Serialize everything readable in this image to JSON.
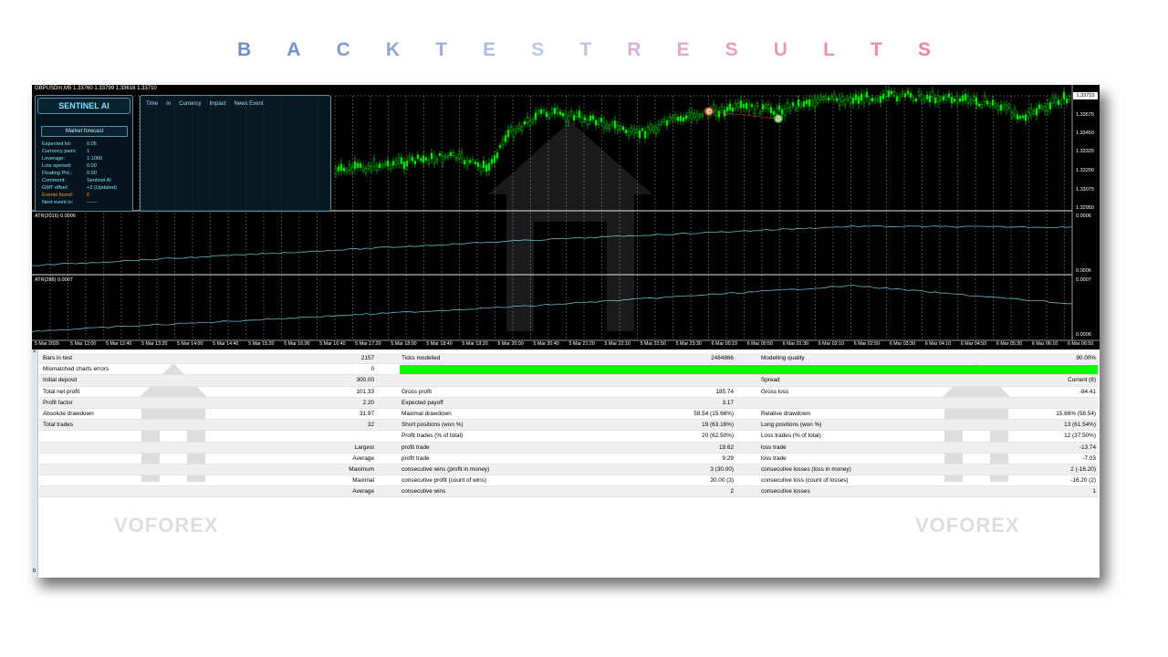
{
  "title_letters": [
    {
      "ch": "B",
      "color": "#6f8fc9"
    },
    {
      "ch": "A",
      "color": "#7294cb"
    },
    {
      "ch": "C",
      "color": "#7f9bd0"
    },
    {
      "ch": "K",
      "color": "#8aa6d6"
    },
    {
      "ch": "T",
      "color": "#97b2da"
    },
    {
      "ch": "E",
      "color": "#a7c0de"
    },
    {
      "ch": "S",
      "color": "#b9c8e3"
    },
    {
      "ch": "T",
      "color": "#d1b8e2"
    },
    {
      "ch": "R",
      "color": "#d9b0d8"
    },
    {
      "ch": "E",
      "color": "#e2a9cd"
    },
    {
      "ch": "S",
      "color": "#e6a1c0"
    },
    {
      "ch": "U",
      "color": "#e89ab6"
    },
    {
      "ch": "L",
      "color": "#ea93ad"
    },
    {
      "ch": "T",
      "color": "#ec8ca5"
    },
    {
      "ch": "S",
      "color": "#ed879e"
    }
  ],
  "chart": {
    "symbol_line": "GBPUSDm,M5  1.33760 1.33799 1.33616 1.33710",
    "price_labels": [
      "1.33575",
      "1.33450",
      "1.33325",
      "1.33200",
      "1.33075",
      "1.32950"
    ],
    "current_price": "1.33710",
    "atr1_label": "ATR(2016) 0.0006",
    "atr1_top": "0.0006",
    "atr1_bottom": "0.0006",
    "atr2_label": "ATR(288) 0.0007",
    "atr2_top": "0.0007",
    "atr2_bottom": "0.0006",
    "time_labels": [
      "5 Mar 2026",
      "5 Mar 12:00",
      "5 Mar 12:40",
      "5 Mar 13:20",
      "5 Mar 14:00",
      "5 Mar 14:40",
      "5 Mar 15:20",
      "5 Mar 16:00",
      "5 Mar 16:40",
      "5 Mar 17:20",
      "5 Mar 18:00",
      "5 Mar 18:40",
      "5 Mar 19:20",
      "5 Mar 20:00",
      "5 Mar 20:40",
      "5 Mar 21:20",
      "5 Mar 22:10",
      "5 Mar 22:50",
      "5 Mar 23:30",
      "6 Mar 00:10",
      "6 Mar 00:50",
      "6 Mar 01:30",
      "6 Mar 02:10",
      "6 Mar 02:50",
      "6 Mar 03:30",
      "6 Mar 04:10",
      "6 Mar 04:50",
      "6 Mar 05:30",
      "6 Mar 06:10",
      "6 Mar 06:50"
    ],
    "colors": {
      "candle": "#00e000",
      "grid": "#8a8a8a",
      "atr": "#5fb8c8",
      "panel_border": "#5a8ea8"
    }
  },
  "panel": {
    "title": "SENTINEL AI",
    "button": "Market forecast",
    "rows": [
      {
        "label": "Expected lot:",
        "value": "0.05",
        "color": "#7fe3ff"
      },
      {
        "label": "Currency pairs:",
        "value": "1",
        "color": "#7fe3ff"
      },
      {
        "label": "Leverage:",
        "value": "1:1000",
        "color": "#7fe3ff"
      },
      {
        "label": "Lots opened:",
        "value": "0.00",
        "color": "#7fe3ff"
      },
      {
        "label": "Floating PnL:",
        "value": "0.00",
        "color": "#7fe3ff"
      },
      {
        "label": "Comment:",
        "value": "Sentinel AI",
        "color": "#7fe3ff"
      },
      {
        "label": "GMT offset:",
        "value": "+2 (Updated)",
        "color": "#7fe3ff"
      },
      {
        "label": "Events found:",
        "value": "0",
        "color": "#f0a020"
      },
      {
        "label": "Next event in:",
        "value": "------",
        "color": "#7fe3ff"
      }
    ]
  },
  "news": {
    "columns": [
      "Time",
      "In",
      "Currency",
      "Impact",
      "News Event"
    ]
  },
  "report": {
    "rows": [
      {
        "c1": "Bars in test",
        "c2": "2157",
        "c3": "Ticks modelled",
        "c4": "2484866",
        "c5": "Modelling quality",
        "c6": "90.00%"
      },
      {
        "c1": "Mismatched charts errors",
        "c2": "0",
        "c3": "",
        "c4": "",
        "c5": "",
        "c6": "",
        "bar": true
      },
      {
        "c1": "Initial deposit",
        "c2": "300.00",
        "c3": "",
        "c4": "",
        "c5": "Spread",
        "c6": "Current (8)"
      },
      {
        "c1": "Total net profit",
        "c2": "101.33",
        "c3": "Gross profit",
        "c4": "185.74",
        "c5": "Gross loss",
        "c6": "-84.41"
      },
      {
        "c1": "Profit factor",
        "c2": "2.20",
        "c3": "Expected payoff",
        "c4": "3.17",
        "c5": "",
        "c6": ""
      },
      {
        "c1": "Absolute drawdown",
        "c2": "31.97",
        "c3": "Maximal drawdown",
        "c4": "58.54 (15.66%)",
        "c5": "Relative drawdown",
        "c6": "15.66% (58.54)"
      },
      {
        "c1": "Total trades",
        "c2": "32",
        "c3": "Short positions (won %)",
        "c4": "19 (63.16%)",
        "c5": "Long positions (won %)",
        "c6": "13 (61.54%)"
      },
      {
        "c1": "",
        "c2": "",
        "c3": "Profit trades (% of total)",
        "c4": "20 (62.50%)",
        "c5": "Loss trades (% of total)",
        "c6": "12 (37.50%)"
      },
      {
        "c1": "",
        "c2": "Largest",
        "c3": "profit trade",
        "c4": "19.62",
        "c5": "loss trade",
        "c6": "-13.74"
      },
      {
        "c1": "",
        "c2": "Average",
        "c3": "profit trade",
        "c4": "9.29",
        "c5": "loss trade",
        "c6": "-7.03"
      },
      {
        "c1": "",
        "c2": "Maximum",
        "c3": "consecutive wins (profit in money)",
        "c4": "3 (30.00)",
        "c5": "consecutive losses (loss in money)",
        "c6": "2 (-16.20)"
      },
      {
        "c1": "",
        "c2": "Maximal",
        "c3": "consecutive profit (count of wins)",
        "c4": "30.00 (3)",
        "c5": "consecutive loss (count of losses)",
        "c6": "-16.20 (2)"
      },
      {
        "c1": "",
        "c2": "Average",
        "c3": "consecutive wins",
        "c4": "2",
        "c5": "consecutive losses",
        "c6": "1"
      }
    ],
    "side_top": "×",
    "side_bottom": "b",
    "watermark": "VOFOREX"
  }
}
